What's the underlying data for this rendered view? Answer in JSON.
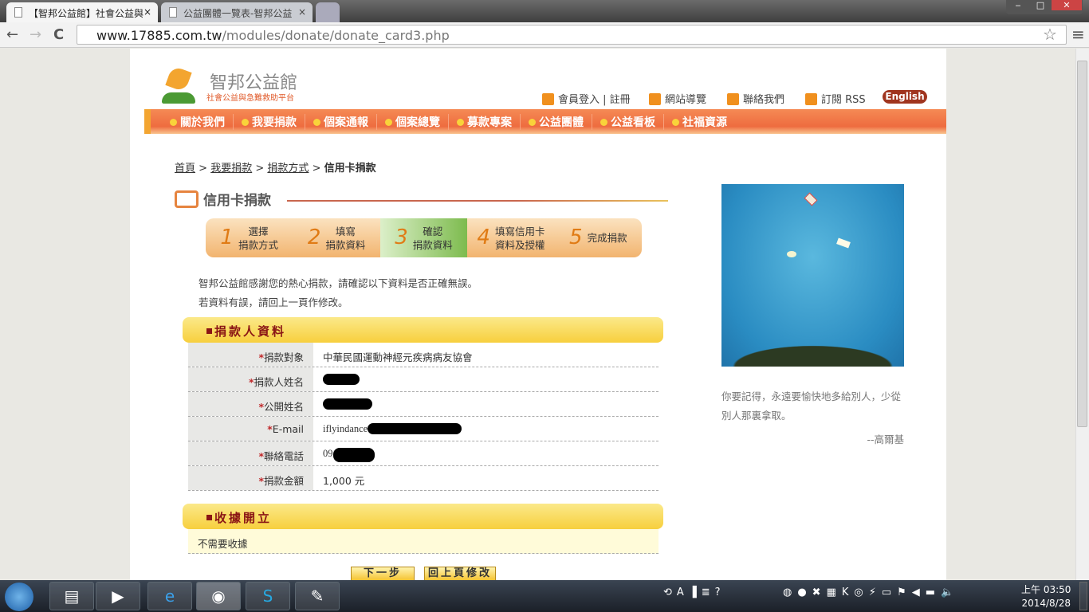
{
  "browser": {
    "tabs": [
      {
        "title": "【智邦公益館】社會公益與",
        "close": "×"
      },
      {
        "title": "公益團體一覽表-智邦公益",
        "close": "×"
      }
    ],
    "url_host": "www.17885.com.tw",
    "url_path": "/modules/donate/donate_card3.php",
    "nav_back": "←",
    "nav_fwd": "→",
    "reload": "C",
    "star": "☆",
    "menu": "≡"
  },
  "site": {
    "logo_title": "智邦公益館",
    "logo_subtitle": "社會公益與急難救助平台",
    "top_links": [
      {
        "label": "會員登入",
        "extra": "註冊"
      },
      {
        "label": "網站導覽"
      },
      {
        "label": "聯絡我們"
      },
      {
        "label": "訂閱 RSS"
      }
    ],
    "english": "English",
    "nav": [
      "關於我們",
      "我要捐款",
      "個案通報",
      "個案總覽",
      "募款專案",
      "公益團體",
      "公益看板",
      "社福資源"
    ]
  },
  "breadcrumb": {
    "items": [
      "首頁",
      "我要捐款",
      "捐款方式"
    ],
    "sep": ">",
    "current": "信用卡捐款"
  },
  "page_title": "信用卡捐款",
  "steps": [
    {
      "num": "1",
      "l1": "選擇",
      "l2": "捐款方式"
    },
    {
      "num": "2",
      "l1": "填寫",
      "l2": "捐款資料"
    },
    {
      "num": "3",
      "l1": "確認",
      "l2": "捐款資料"
    },
    {
      "num": "4",
      "l1": "填寫信用卡",
      "l2": "資料及授權"
    },
    {
      "num": "5",
      "l1": "完成捐款",
      "l2": ""
    }
  ],
  "current_step": 3,
  "intro": [
    "智邦公益館感謝您的熱心捐款，請確認以下資料是否正確無誤。",
    "若資料有誤，請回上一頁作修改。"
  ],
  "donor": {
    "header": "捐款人資料",
    "rows": [
      {
        "label": "捐款對象",
        "value": "中華民國運動神經元疾病病友協會"
      },
      {
        "label": "捐款人姓名",
        "value": ""
      },
      {
        "label": "公開姓名",
        "value": ""
      },
      {
        "label": "E-mail",
        "value": "iflyindance"
      },
      {
        "label": "聯絡電話",
        "value": "09"
      },
      {
        "label": "捐款金額",
        "value": "1,000 元"
      }
    ]
  },
  "receipt": {
    "header": "收據開立",
    "value": "不需要收據"
  },
  "buttons": {
    "next": "下一步",
    "back": "回上頁修改"
  },
  "sidebar": {
    "quote": "你要記得，永遠要愉快地多給別人，少從別人那裏拿取。",
    "author": "--高爾基"
  },
  "taskbar": {
    "time": "上午 03:50",
    "date": "2014/8/28"
  }
}
